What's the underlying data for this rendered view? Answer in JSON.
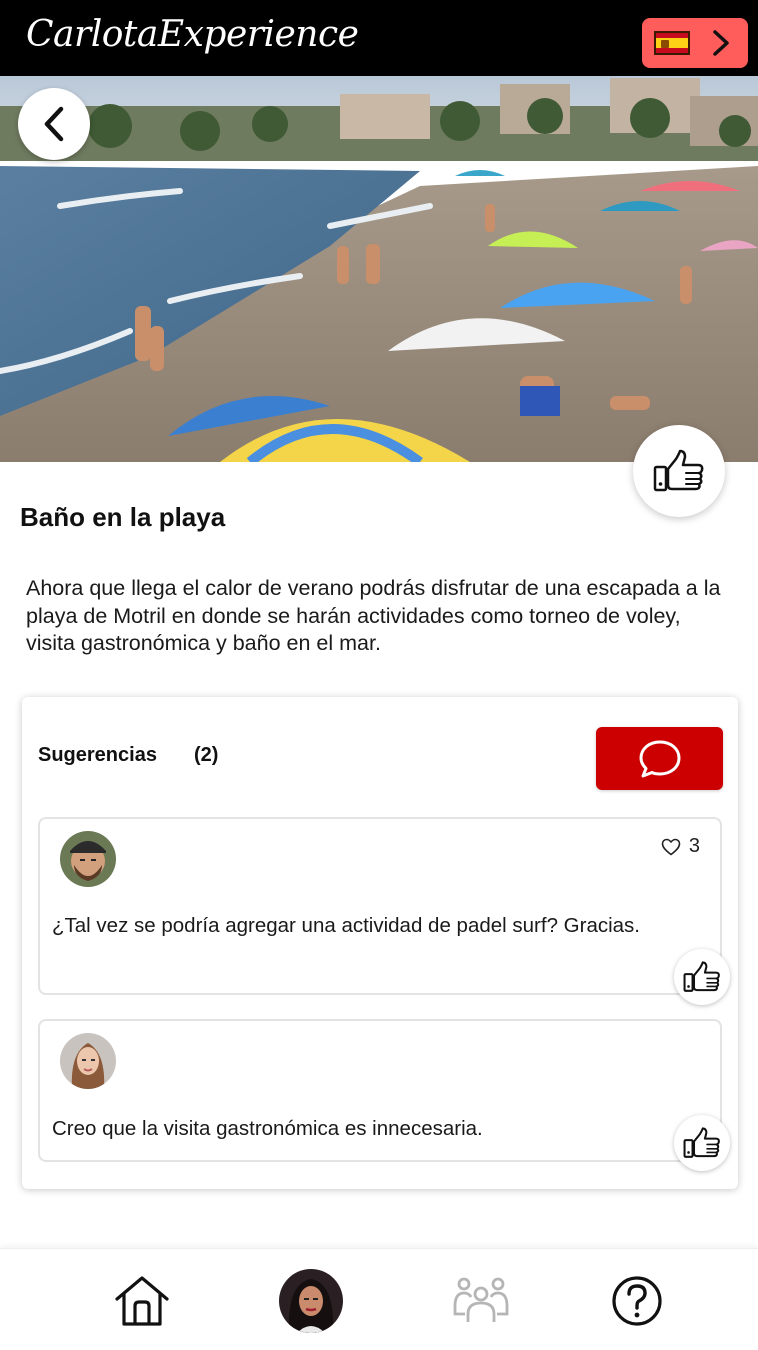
{
  "header": {
    "brand": "CarlotaExperience",
    "language_flag": "spain-flag",
    "language_arrow": "chevron-right-icon"
  },
  "hero": {
    "image": "beach scene with umbrellas and people",
    "back_icon": "chevron-left-icon",
    "like_icon": "thumbs-up-icon"
  },
  "activity": {
    "title": "Baño en la playa",
    "description": "Ahora que llega el calor de verano podrás disfrutar de una escapada a la playa de Motril en donde se harán actividades como torneo de voley, visita gastronómica y baño en el mar."
  },
  "suggestions": {
    "title": "Sugerencias",
    "count": "(2)",
    "comment_icon": "speech-bubble-icon",
    "items": [
      {
        "avatar": "bearded-man-with-cap",
        "likes": "3",
        "text": "¿Tal vez se podría agregar una actividad de padel surf? Gracias."
      },
      {
        "avatar": "woman-with-long-hair",
        "text": "Creo que la visita gastronómica es innecesaria."
      }
    ]
  },
  "bottom_nav": {
    "items": [
      "home-icon",
      "profile-avatar",
      "group-icon",
      "help-icon"
    ]
  },
  "colors": {
    "header_bg": "#000000",
    "lang_button": "#ff5c5c",
    "comment_button": "#cc0000"
  }
}
